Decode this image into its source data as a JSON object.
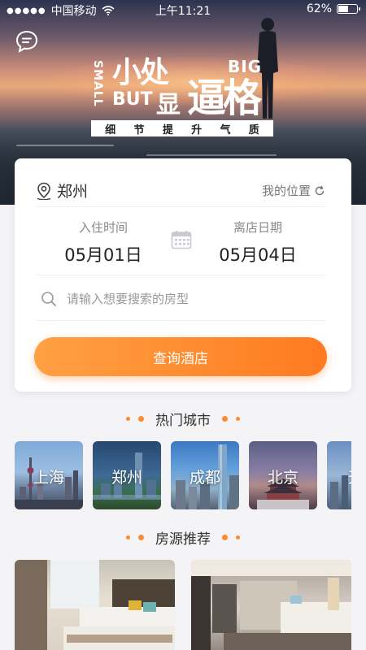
{
  "status_bar": {
    "carrier": "中国移动",
    "time": "上午11:21",
    "battery": "62%",
    "battery_level": 0.62
  },
  "hero": {
    "slogan_small_en": "SMALL",
    "slogan_small_cn": "小处",
    "slogan_but": "BUT",
    "slogan_xian": "显",
    "slogan_big_cn": "逼格",
    "slogan_big_en": "BIG",
    "tagline": [
      "细",
      "节",
      "提",
      "升",
      "气",
      "质"
    ]
  },
  "search": {
    "city": "郑州",
    "my_location": "我的位置",
    "checkin_label": "入住时间",
    "checkin_date": "05月01日",
    "checkout_label": "离店日期",
    "checkout_date": "05月04日",
    "search_placeholder": "请输入想要搜索的房型",
    "submit_label": "查询酒店"
  },
  "hot_cities": {
    "title": "热门城市",
    "items": [
      "上海",
      "郑州",
      "成都",
      "北京",
      "天"
    ]
  },
  "rooms": {
    "title": "房源推荐"
  },
  "colors": {
    "accent": "#ff8a2e",
    "button_start": "#ffa043",
    "button_end": "#ff7a20"
  }
}
